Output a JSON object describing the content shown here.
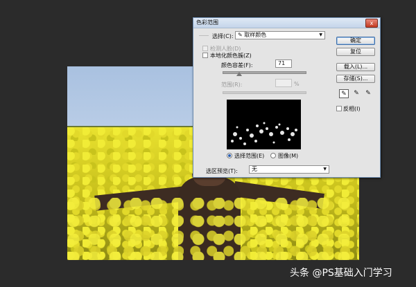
{
  "dialog": {
    "title": "色彩范围",
    "close_glyph": "x",
    "select_label": "选择(C):",
    "select_icon": "eyedropper-icon",
    "select_value": "取样颜色",
    "detect_faces_label": "检测人脸(D)",
    "localized_clusters_label": "本地化颜色簇(Z)",
    "fuzziness_label": "颜色容差(F):",
    "fuzziness_value": "71",
    "fuzziness_fraction": 0.2,
    "range_label": "范围(R):",
    "range_unit": "%",
    "preview_mode_selection": "选择范围(E)",
    "preview_mode_image": "图像(M)",
    "selection_preview_label": "选区预览(T):",
    "selection_preview_value": "无",
    "buttons": {
      "ok": "确定",
      "reset": "复位",
      "load": "载入(L)...",
      "save": "存储(S)..."
    },
    "invert_label": "反相(I)",
    "tools": [
      "eyedropper-icon",
      "eyedropper-plus-icon",
      "eyedropper-minus-icon"
    ]
  },
  "watermark": "头条 @PS基础入门学习"
}
